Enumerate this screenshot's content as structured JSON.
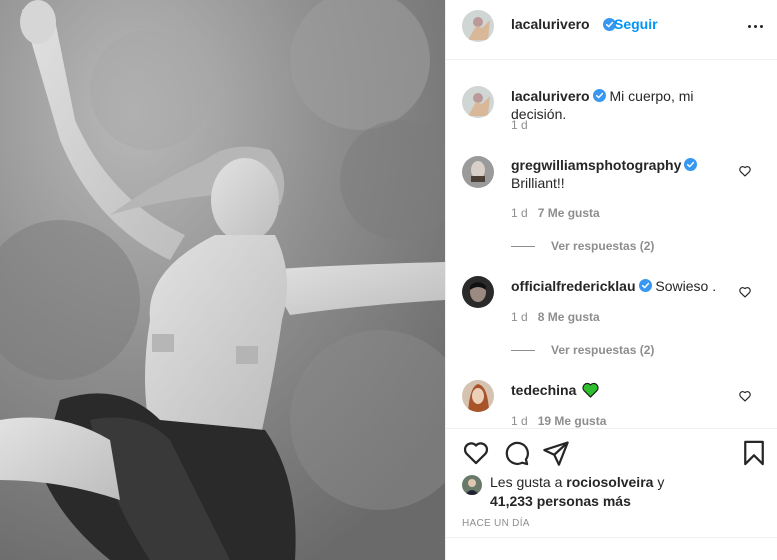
{
  "header": {
    "username": "lacalurivero",
    "separator": "•",
    "follow_label": "Seguir"
  },
  "caption": {
    "username": "lacalurivero",
    "text": "Mi cuerpo, mi decisión.",
    "time": "1 d"
  },
  "comments": [
    {
      "username": "gregwilliamsphotography",
      "text": "Brilliant!!",
      "verified": true,
      "time": "1 d",
      "likes": "7 Me gusta",
      "replies": "Ver respuestas (2)"
    },
    {
      "username": "officialfredericklau",
      "text": "Sowieso .",
      "verified": true,
      "time": "1 d",
      "likes": "8 Me gusta",
      "replies": "Ver respuestas (2)"
    },
    {
      "username": "tedechina",
      "text": "",
      "emoji": "green-heart-icon",
      "verified": false,
      "time": "1 d",
      "likes": "19 Me gusta"
    }
  ],
  "likes": {
    "prefix": "Les gusta a",
    "user": "rocio​solveira",
    "conj": "y",
    "count": "41,233 personas más"
  },
  "timestamp": "HACE UN DÍA",
  "colors": {
    "accent": "#0095f6",
    "verified": "#3897f0",
    "muted": "#8e8e8e",
    "text": "#262626",
    "green_heart": "#2fbf2f"
  },
  "icons": [
    "verified-badge-icon",
    "more-options-icon",
    "heart-icon",
    "comment-icon",
    "share-icon",
    "bookmark-icon",
    "green-heart-icon"
  ]
}
